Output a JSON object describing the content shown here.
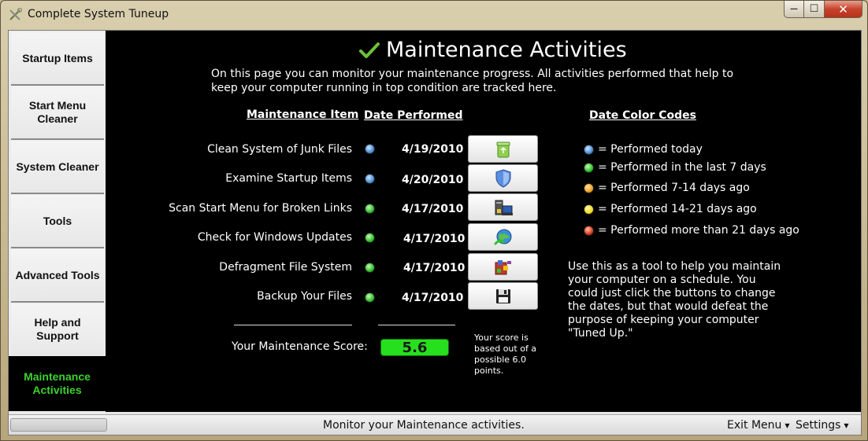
{
  "window": {
    "title": "Complete System Tuneup",
    "minimize_glyph": "—",
    "maximize_glyph": "☐",
    "close_glyph": "✕"
  },
  "sidebar": {
    "items": [
      {
        "label": "Startup Items",
        "active": false
      },
      {
        "label": "Start Menu Cleaner",
        "active": false
      },
      {
        "label": "System Cleaner",
        "active": false
      },
      {
        "label": "Tools",
        "active": false
      },
      {
        "label": "Advanced Tools",
        "active": false
      },
      {
        "label": "Help and Support",
        "active": false
      },
      {
        "label": "Maintenance Activities",
        "active": true
      }
    ]
  },
  "main": {
    "title": "Maintenance Activities",
    "title_icon": "checkmark-icon",
    "intro": "On this page you can monitor your maintenance progress. All activities performed that help to keep your computer running in top condition are tracked here.",
    "col_item": "Maintenance Item",
    "col_date": "Date Performed",
    "col_legend": "Date Color Codes",
    "rows": [
      {
        "label": "Clean System of Junk Files",
        "status": "today",
        "date": "4/19/2010",
        "icon": "recycle-bin-icon"
      },
      {
        "label": "Examine Startup Items",
        "status": "today",
        "date": "4/20/2010",
        "icon": "shield-icon"
      },
      {
        "label": "Scan Start Menu for Broken Links",
        "status": "last7",
        "date": "4/17/2010",
        "icon": "computer-icon"
      },
      {
        "label": "Check for Windows Updates",
        "status": "last7",
        "date": "4/17/2010",
        "icon": "globe-update-icon"
      },
      {
        "label": "Defragment File System",
        "status": "last7",
        "date": "4/17/2010",
        "icon": "defrag-icon"
      },
      {
        "label": "Backup Your Files",
        "status": "last7",
        "date": "4/17/2010",
        "icon": "floppy-disk-icon"
      }
    ],
    "score_label": "Your Maintenance Score:",
    "score_value": "5.6",
    "score_note": "Your score is based out of a possible 6.0 points.",
    "legend": [
      {
        "status": "today",
        "text": "= Performed today"
      },
      {
        "status": "last7",
        "text": "= Performed in the last 7 days"
      },
      {
        "status": "7to14",
        "text": "= Performed 7-14 days ago"
      },
      {
        "status": "14to21",
        "text": "= Performed 14-21 days ago"
      },
      {
        "status": "over21",
        "text": "= Performed more than 21 days ago"
      }
    ],
    "advice": "Use this as a tool to help you maintain your computer on a schedule. You could just click the buttons to change the dates, but that would defeat the purpose of keeping your computer \"Tuned Up.\""
  },
  "colors": {
    "today": "#4a90d9",
    "last7": "#2ec42a",
    "7to14": "#f0a020",
    "14to21": "#f2dc1a",
    "over21": "#e03a20",
    "score_bg": "#27e01d",
    "active_nav": "#3bd12e"
  },
  "statusbar": {
    "text": "Monitor your Maintenance activities.",
    "exit_menu": "Exit Menu",
    "settings": "Settings"
  }
}
